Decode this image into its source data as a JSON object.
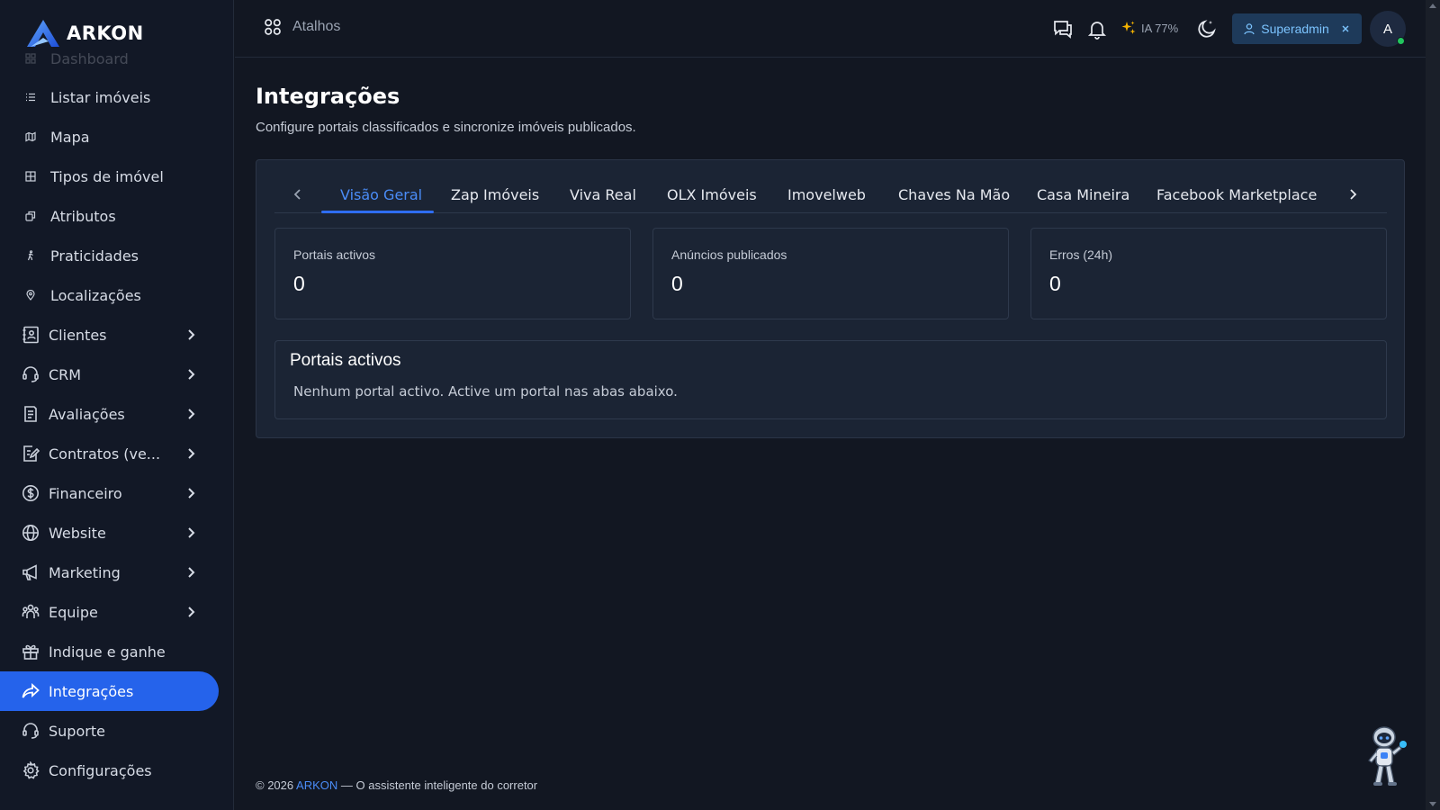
{
  "brand": {
    "name": "ARKON",
    "accent": "#2563eb"
  },
  "sidebar": {
    "items": [
      {
        "label": "Dashboard",
        "icon": "dashboard-icon"
      },
      {
        "label": "Listar imóveis",
        "icon": "list-icon"
      },
      {
        "label": "Mapa",
        "icon": "map-icon"
      },
      {
        "label": "Tipos de imóvel",
        "icon": "grid-icon"
      },
      {
        "label": "Atributos",
        "icon": "attributes-icon"
      },
      {
        "label": "Praticidades",
        "icon": "walking-icon"
      },
      {
        "label": "Localizações",
        "icon": "location-pin-icon"
      },
      {
        "label": "Clientes",
        "icon": "contacts-book-icon"
      },
      {
        "label": "CRM",
        "icon": "headset-icon"
      },
      {
        "label": "Avaliações",
        "icon": "clipboard-icon"
      },
      {
        "label": "Contratos (ve...",
        "icon": "contract-edit-icon"
      },
      {
        "label": "Financeiro",
        "icon": "dollar-coin-icon"
      },
      {
        "label": "Website",
        "icon": "globe-icon"
      },
      {
        "label": "Marketing",
        "icon": "megaphone-icon"
      },
      {
        "label": "Equipe",
        "icon": "team-icon"
      },
      {
        "label": "Indique e ganhe",
        "icon": "gift-icon"
      },
      {
        "label": "Integrações",
        "icon": "share-arrow-icon"
      },
      {
        "label": "Suporte",
        "icon": "support-headset-icon"
      },
      {
        "label": "Configurações",
        "icon": "gear-icon"
      }
    ]
  },
  "header": {
    "shortcuts_label": "Atalhos",
    "ia_label": "IA 77%",
    "role_label": "Superadmin",
    "avatar_initial": "A"
  },
  "main": {
    "title": "Integrações",
    "subtitle": "Configure portais classificados e sincronize imóveis publicados.",
    "tabs": [
      "Visão Geral",
      "Zap Imóveis",
      "Viva Real",
      "OLX Imóveis",
      "Imovelweb",
      "Chaves Na Mão",
      "Casa Mineira",
      "Facebook Marketplace"
    ],
    "stats": [
      {
        "label": "Portais activos",
        "value": "0"
      },
      {
        "label": "Anúncios publicados",
        "value": "0"
      },
      {
        "label": "Erros (24h)",
        "value": "0"
      }
    ],
    "portals": {
      "title": "Portais activos",
      "empty_text": "Nenhum portal activo. Active um portal nas abas abaixo."
    }
  },
  "footer": {
    "prefix": "© 2026",
    "brand": "ARKON",
    "suffix": "— O assistente inteligente do corretor"
  }
}
